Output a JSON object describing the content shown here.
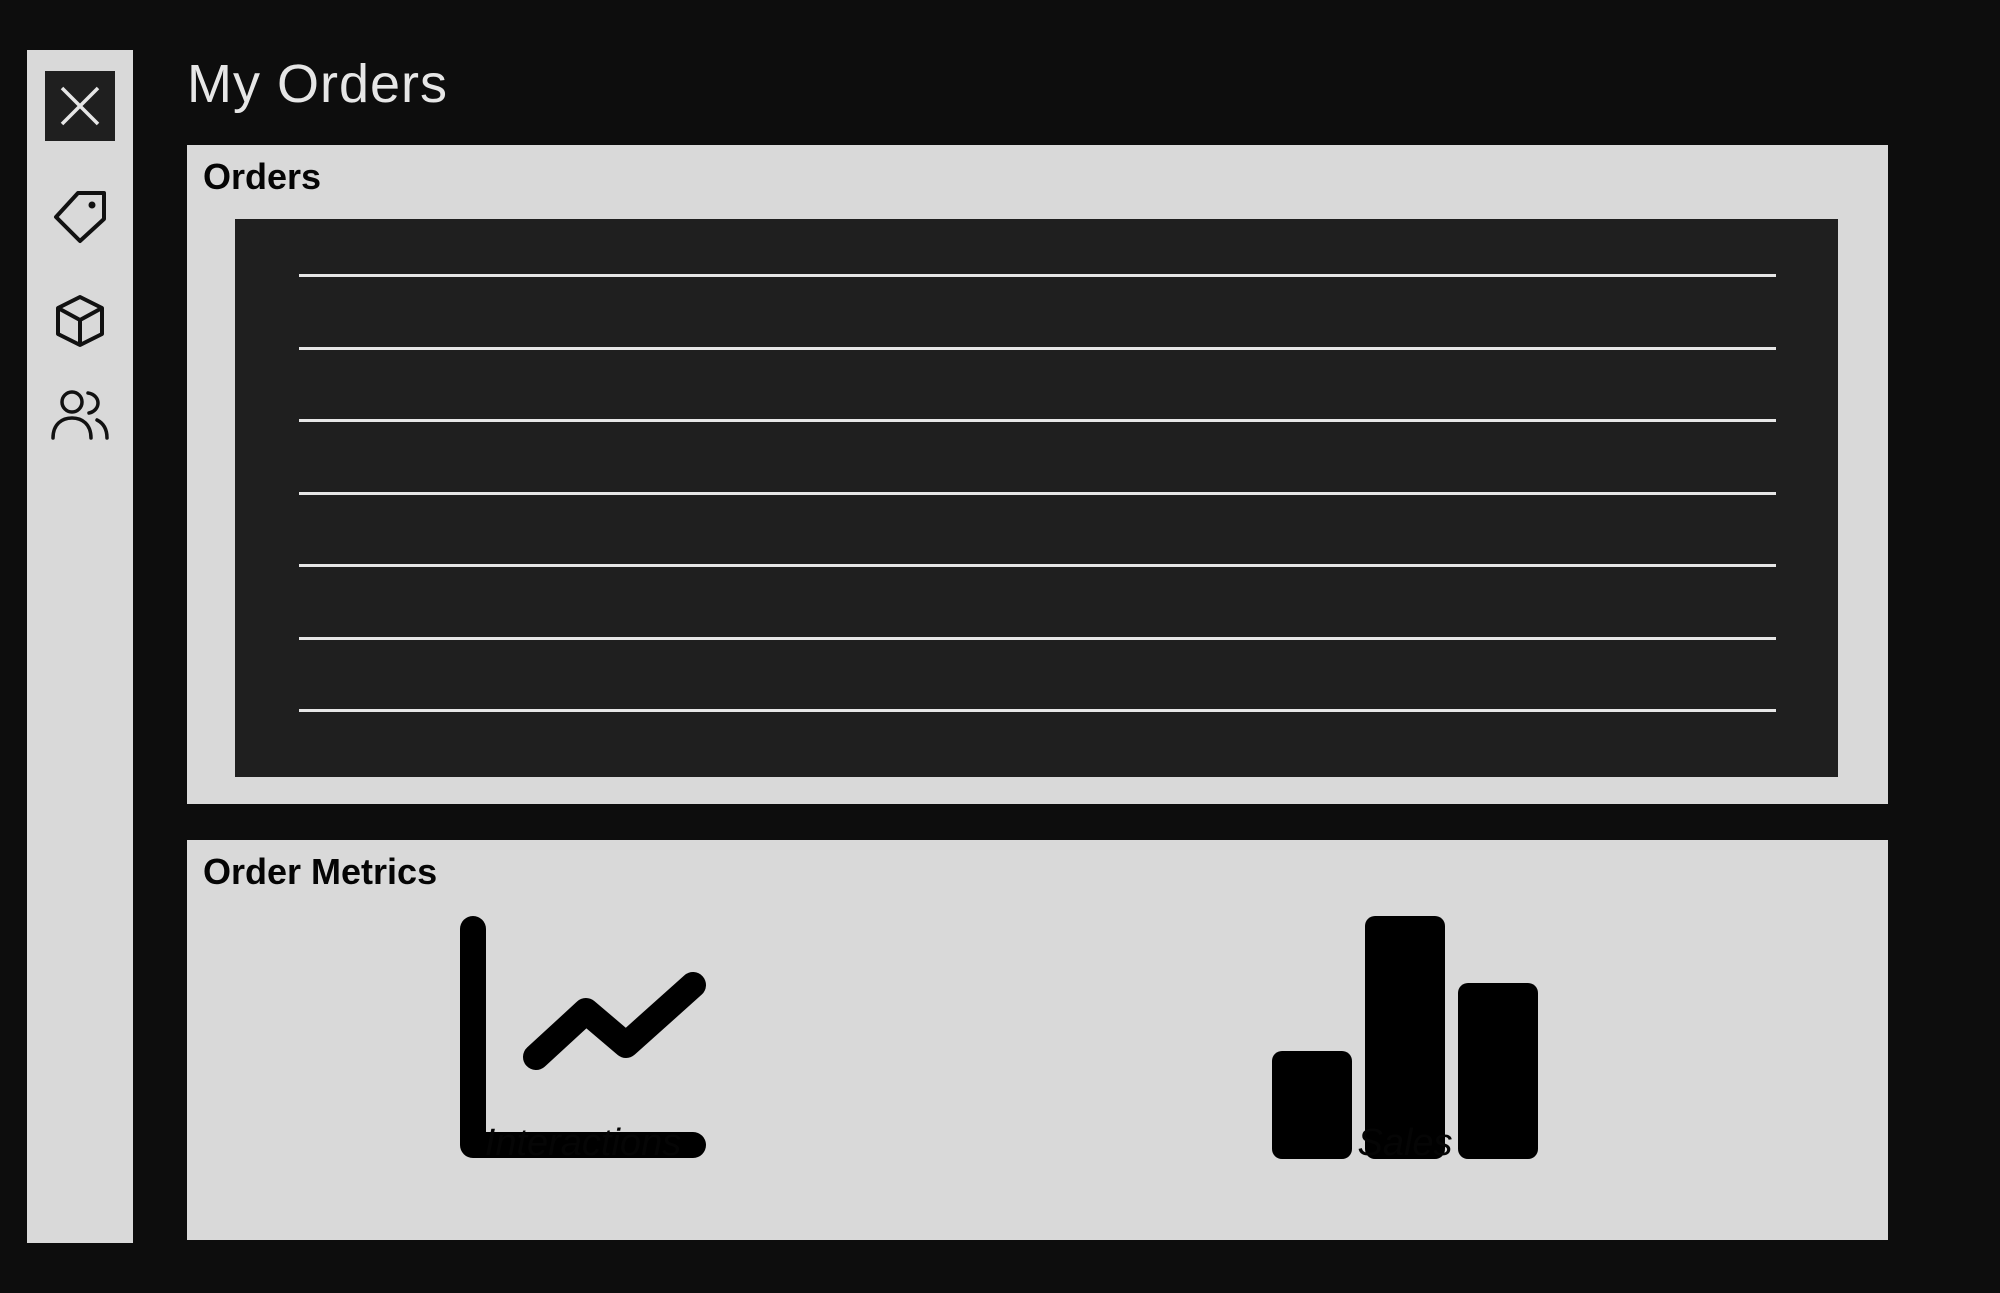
{
  "page": {
    "title": "My Orders"
  },
  "sidebar": {
    "items": [
      {
        "icon": "close-icon"
      },
      {
        "icon": "tag-icon"
      },
      {
        "icon": "box-icon"
      },
      {
        "icon": "users-icon"
      }
    ]
  },
  "orders_panel": {
    "title": "Orders",
    "row_count": 7
  },
  "metrics_panel": {
    "title": "Order Metrics",
    "tiles": [
      {
        "label": "Interactions",
        "icon": "line-chart-icon"
      },
      {
        "label": "Sales",
        "icon": "bar-chart-icon"
      }
    ]
  },
  "colors": {
    "background": "#0d0d0d",
    "panel": "#d9d9d9",
    "list_background": "#1f1f1f",
    "row_line": "#e6e6e6",
    "title_text": "#e6e6e6"
  }
}
